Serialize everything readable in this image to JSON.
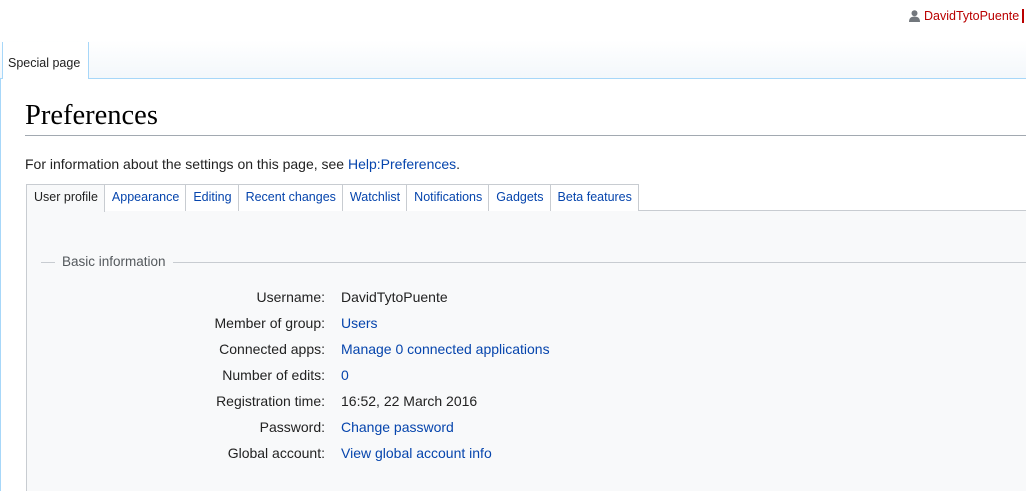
{
  "personal": {
    "username": "DavidTytoPuente",
    "icon": "user-icon",
    "color": "#ba0000"
  },
  "page_tab": {
    "label": "Special page"
  },
  "title": "Preferences",
  "intro": {
    "text": "For information about the settings on this page, see ",
    "link": "Help:Preferences",
    "suffix": "."
  },
  "tabs": [
    {
      "label": "User profile",
      "active": true
    },
    {
      "label": "Appearance",
      "active": false
    },
    {
      "label": "Editing",
      "active": false
    },
    {
      "label": "Recent changes",
      "active": false
    },
    {
      "label": "Watchlist",
      "active": false
    },
    {
      "label": "Notifications",
      "active": false
    },
    {
      "label": "Gadgets",
      "active": false
    },
    {
      "label": "Beta features",
      "active": false
    }
  ],
  "basic_information": {
    "legend": "Basic information",
    "rows": [
      {
        "label": "Username:",
        "value": "DavidTytoPuente",
        "is_link": false
      },
      {
        "label": "Member of group:",
        "value": "Users",
        "is_link": true
      },
      {
        "label": "Connected apps:",
        "value": "Manage 0 connected applications",
        "is_link": true
      },
      {
        "label": "Number of edits:",
        "value": "0",
        "is_link": true
      },
      {
        "label": "Registration time:",
        "value": "16:52, 22 March 2016",
        "is_link": false
      },
      {
        "label": "Password:",
        "value": "Change password",
        "is_link": true
      },
      {
        "label": "Global account:",
        "value": "View global account info",
        "is_link": true
      }
    ]
  },
  "colors": {
    "link": "#0645ad",
    "border": "#a7d7f9",
    "panel_bg": "#f8f9fa"
  }
}
